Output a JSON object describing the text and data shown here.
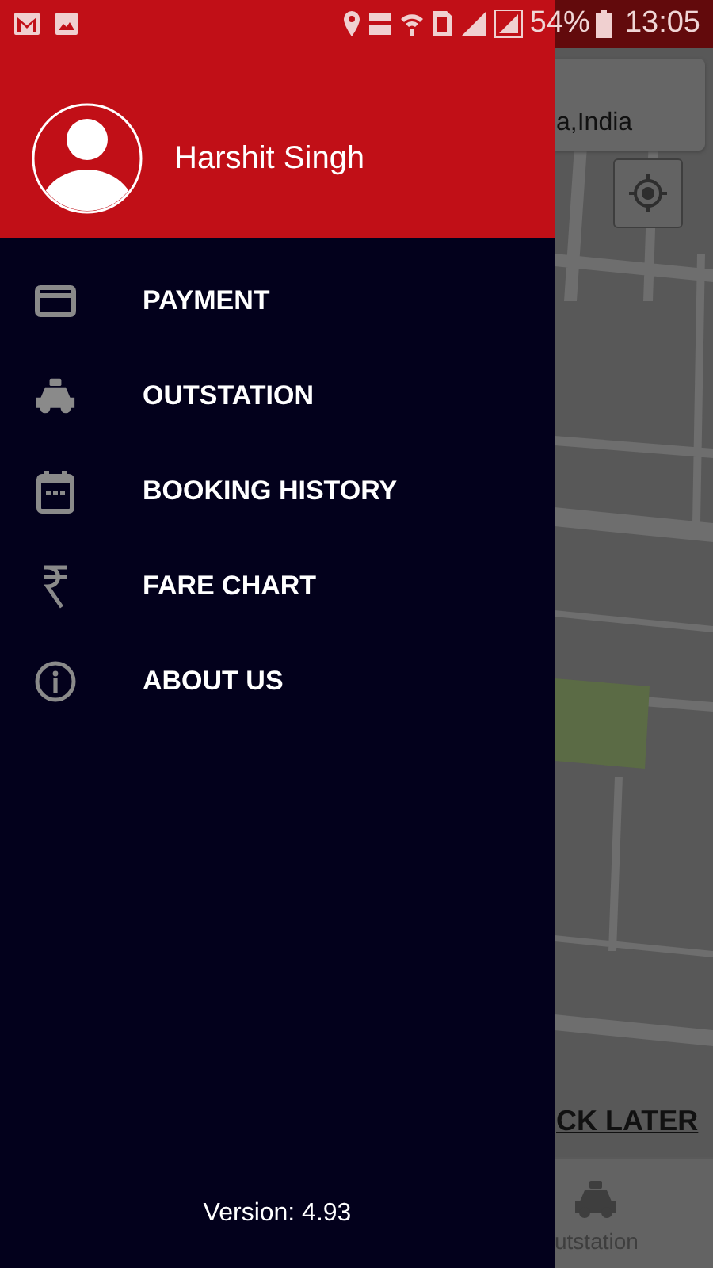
{
  "status_bar": {
    "battery": "54%",
    "time": "13:05"
  },
  "drawer": {
    "user_name": "Harshit Singh",
    "version": "Version: 4.93",
    "menu": [
      {
        "kind": "card",
        "label": "PAYMENT"
      },
      {
        "kind": "car",
        "label": "OUTSTATION"
      },
      {
        "kind": "calendar",
        "label": "BOOKING HISTORY"
      },
      {
        "kind": "rupee",
        "label": "FARE CHART"
      },
      {
        "kind": "info",
        "label": "ABOUT US"
      }
    ]
  },
  "background": {
    "search_text": "a,India",
    "action": "CK LATER",
    "tab_label": "utstation"
  }
}
